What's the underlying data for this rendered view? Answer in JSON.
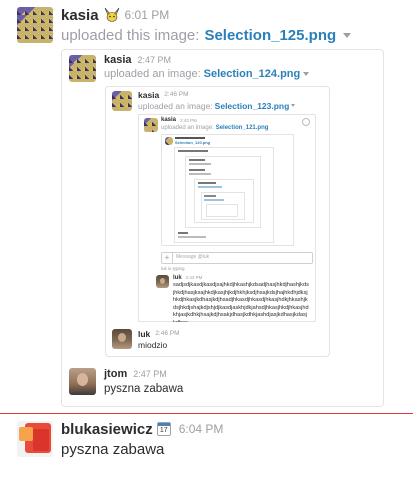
{
  "msg1": {
    "author": "kasia",
    "time": "6:01 PM",
    "action": "uploaded this image:",
    "file": "Selection_125.png"
  },
  "nest1": {
    "author": "kasia",
    "time": "2:47 PM",
    "action": "uploaded an image:",
    "file": "Selection_124.png"
  },
  "nest2": {
    "author": "kasia",
    "time": "2:46 PM",
    "action": "uploaded an image:",
    "file": "Selection_123.png"
  },
  "nest3": {
    "author": "kasia",
    "time": "2:43 PM",
    "action": "uploaded an image:",
    "file": "Selection_121.png",
    "inner_file": "Selection_120.png",
    "composer_placeholder": "Message @luk",
    "typing": "luk is typing",
    "luk_author": "luk",
    "luk_time": "2:43 PM",
    "luk_text": "sadjsdjkasdjkasdjsajhkdjhkashjkdsadjhasjhkdjhashjkdsjhkdjhasjksajhkdjkasjhjkdjhkhjksdjhsajkdsjhajhkdhjdksjhkdjhkasjkdhasjkdjhsadjhkasdjhkasdjhkasjhdkjhkashjkdsjhkdjshajkdjshjdjkasdjaskhjdkjahsdjhkasjhkdjhkasjhdkhjasjkdhkjhsajkdjhsakjdhasjkdhkjashdjasjkdhasjkdasjkdhas"
  },
  "nest2_reply": {
    "author": "luk",
    "time": "2:46 PM",
    "text": "miodzio"
  },
  "nest1_reply": {
    "author": "jtom",
    "time": "2:47 PM",
    "text": "pyszna zabawa"
  },
  "msg2": {
    "author": "blukasiewicz",
    "badge": "17",
    "time": "6:04 PM",
    "text": "pyszna zabawa"
  },
  "colors": {
    "link": "#2a80b9",
    "divider": "#e03a3a",
    "name": "#2c2d30",
    "meta": "#9e9ea6"
  }
}
